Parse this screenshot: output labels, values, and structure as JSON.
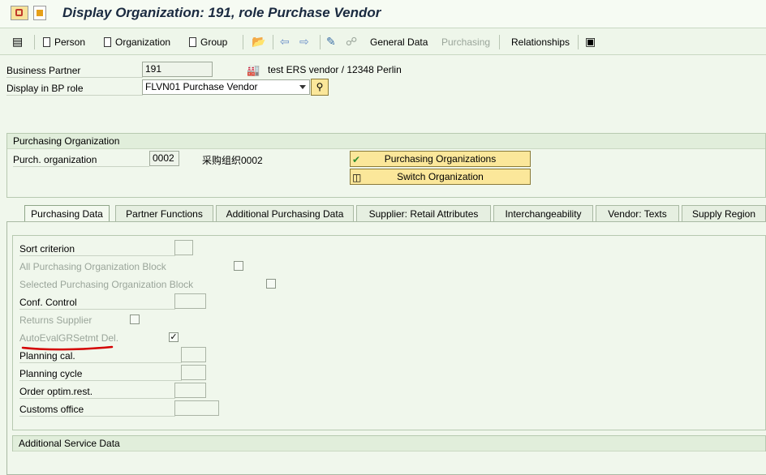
{
  "title": "Display Organization: 191, role Purchase Vendor",
  "toolbar": {
    "person": "Person",
    "organization": "Organization",
    "group": "Group",
    "general_data": "General Data",
    "purchasing": "Purchasing",
    "relationships": "Relationships"
  },
  "header": {
    "bp_label": "Business Partner",
    "bp_value": "191",
    "bp_desc": "test ERS vendor / 12348 Perlin",
    "role_label": "Display in BP role",
    "role_value": "FLVN01 Purchase Vendor"
  },
  "purch_org": {
    "section_title": "Purchasing Organization",
    "label": "Purch. organization",
    "value": "0002",
    "desc": "采购组织0002",
    "btn_orgs": "Purchasing Organizations",
    "btn_switch": "Switch Organization"
  },
  "tabs": [
    "Purchasing Data",
    "Partner Functions",
    "Additional Purchasing Data",
    "Supplier: Retail Attributes",
    "Interchangeability",
    "Vendor: Texts",
    "Supply Region"
  ],
  "fields": {
    "sort_criterion": "Sort criterion",
    "all_block": "All Purchasing Organization Block",
    "selected_block": "Selected Purchasing Organization Block",
    "conf_control": "Conf. Control",
    "returns_supplier": "Returns Supplier",
    "auto_eval": "AutoEvalGRSetmt Del.",
    "planning_cal": "Planning cal.",
    "planning_cycle": "Planning cycle",
    "order_optim": "Order optim.rest.",
    "customs_office": "Customs office"
  },
  "additional_service": "Additional Service Data",
  "colors": {
    "highlight_underline": "#d40000",
    "button_bg": "#fbe79a"
  }
}
